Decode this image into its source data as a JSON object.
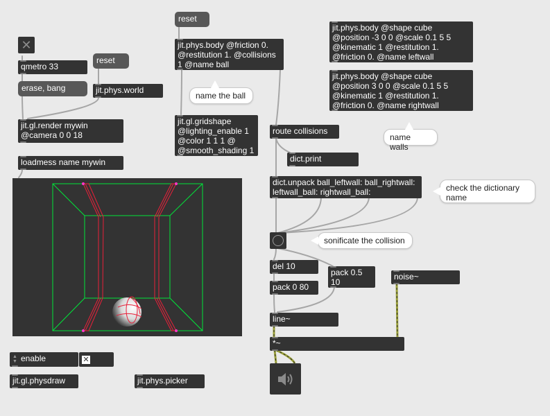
{
  "objects": {
    "toggle_top": "✕",
    "qmetro": "qmetro 33",
    "erase_bang": "erase, bang",
    "reset_world": "reset",
    "phys_world": "jit.phys.world",
    "render": "jit.gl.render mywin @camera 0 0 18",
    "loadmess": "loadmess name mywin",
    "reset_body": "reset",
    "phys_body_ball": "jit.phys.body @friction 0. @restitution 1. @collisions 1 @name ball",
    "gridshape": "jit.gl.gridshape @lighting_enable 1 @color 1 1 1 @ @smooth_shading 1",
    "leftwall": "jit.phys.body @shape cube @position -3 0 0 @scale 0.1 5 5 @kinematic 1 @restitution 1. @friction 0. @name leftwall",
    "rightwall": "jit.phys.body @shape cube @position 3 0 0 @scale 0.1 5 5 @kinematic 1 @restitution 1. @friction 0. @name rightwall",
    "route": "route collisions",
    "dict_print": "dict.print",
    "dict_unpack": "dict.unpack ball_leftwall: ball_rightwall: leftwall_ball: rightwall_ball:",
    "del": "del 10",
    "pack_080": "pack 0 80",
    "pack_05": "pack 0.5 10",
    "noise": "noise~",
    "line": "line~",
    "times": "*~",
    "enable_menu": "enable",
    "physdraw": "jit.gl.physdraw",
    "picker": "jit.phys.picker"
  },
  "comments": {
    "name_ball": "name the ball",
    "name_walls": "name walls",
    "check_dict": "check the dictionary name",
    "sonificate": "sonificate the collision"
  },
  "colors": {
    "patch_bg": "#eaeaea",
    "object_bg": "#333333",
    "message_bg": "#585858",
    "cord_signal": "#c9d36a",
    "render_box": "#00ff33",
    "walls": "#ff2233"
  }
}
